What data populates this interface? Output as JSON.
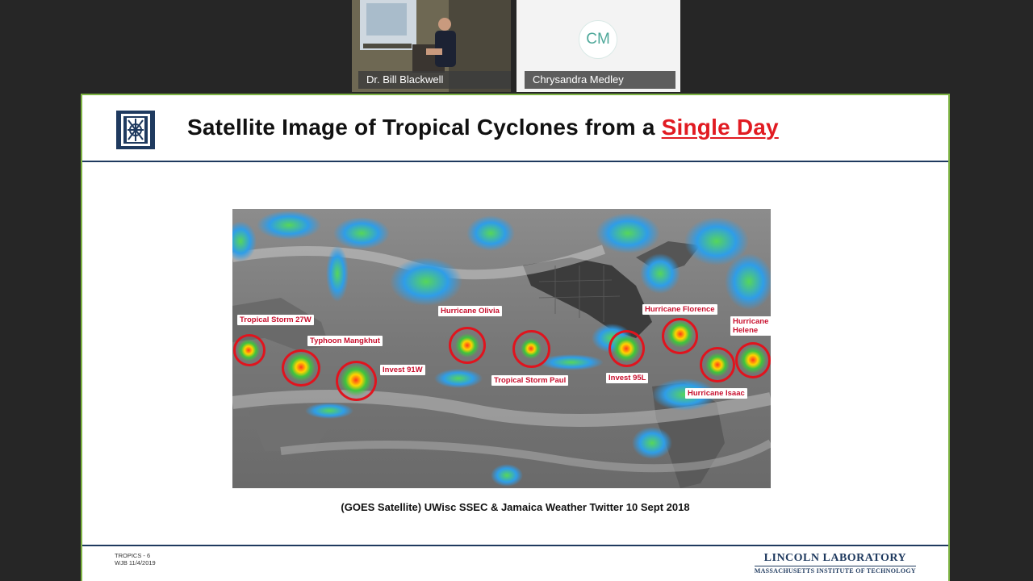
{
  "participants": [
    {
      "name": "Dr. Bill Blackwell",
      "type": "video"
    },
    {
      "name": "Chrysandra Medley",
      "type": "avatar",
      "initials": "CM"
    }
  ],
  "slide": {
    "title_main": "Satellite Image of Tropical Cyclones from a ",
    "title_highlight": "Single Day",
    "caption": "(GOES Satellite) UWisc SSEC & Jamaica Weather Twitter 10 Sept 2018",
    "footer_line1": "TROPICS - 6",
    "footer_line2": "WJB  11/4/2019",
    "org_name": "LINCOLN LABORATORY",
    "org_sub": "MASSACHUSETTS INSTITUTE OF TECHNOLOGY",
    "storms": [
      "Tropical Storm 27W",
      "Typhoon Mangkhut",
      "Invest 91W",
      "Hurricane Olivia",
      "Tropical Storm Paul",
      "Invest 95L",
      "Hurricane Florence",
      "Hurricane Isaac",
      "Hurricane Helene"
    ]
  },
  "colors": {
    "accent_red": "#e11b22",
    "circle_red": "#e0141e",
    "navy": "#1f3a5f",
    "slide_border": "#7db343"
  }
}
